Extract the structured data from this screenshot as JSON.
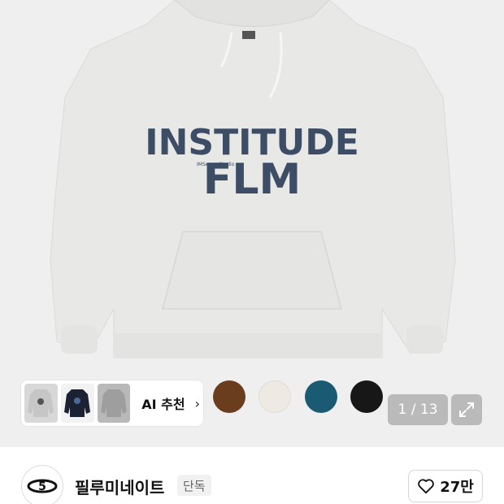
{
  "product_image": {
    "print_text_top": "INSTITUDE",
    "print_text_bottom": "FLM",
    "tag_text": "IMSeoya Studio",
    "icon": "hoodie-image"
  },
  "ai_recommend": {
    "label": "AI 추천",
    "chevron_icon": "chevron-right-icon",
    "thumbnails": [
      "gray-hoodie",
      "navy-hoodie",
      "light-gray-hoodie"
    ]
  },
  "colors": {
    "swatches": [
      {
        "name": "brown",
        "hex": "#6b3d1f"
      },
      {
        "name": "cream",
        "hex": "#eee9e2"
      },
      {
        "name": "teal",
        "hex": "#1b5a73"
      },
      {
        "name": "black",
        "hex": "#171717"
      }
    ],
    "hoodie": "#e9e9e7",
    "print": "#3d4d66"
  },
  "pager": {
    "text": "1 / 13",
    "expand_icon": "expand-icon"
  },
  "brand": {
    "name": "필루미네이트",
    "badge": "단독",
    "logo_icon": "brand-logo-icon"
  },
  "like": {
    "icon": "heart-icon",
    "count": "27만"
  }
}
